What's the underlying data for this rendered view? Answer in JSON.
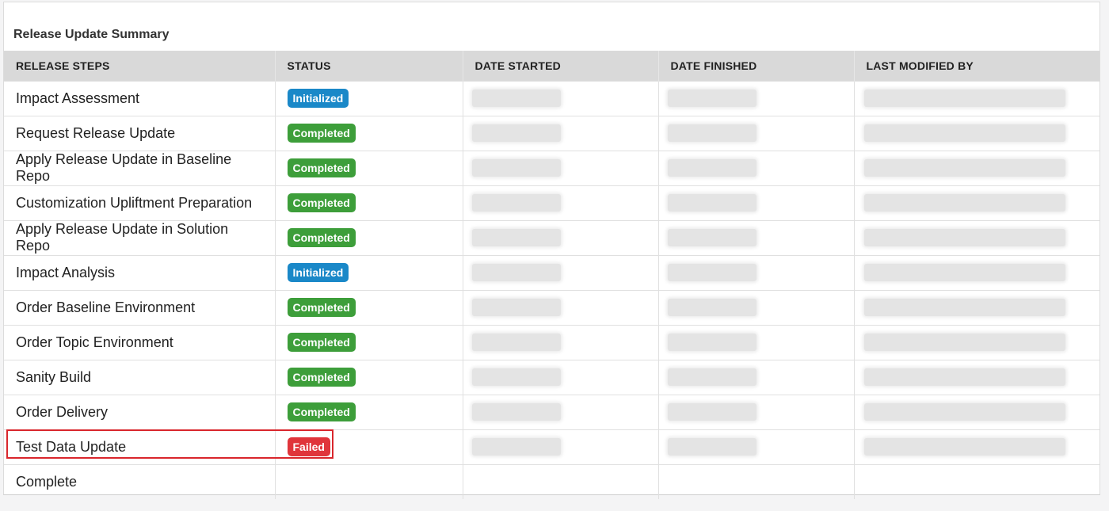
{
  "panel": {
    "title": "Release Update Summary"
  },
  "table": {
    "headers": [
      "RELEASE STEPS",
      "STATUS",
      "DATE STARTED",
      "DATE FINISHED",
      "LAST MODIFIED BY"
    ],
    "rows": [
      {
        "step": "Impact Assessment",
        "status": "Initialized"
      },
      {
        "step": "Request Release Update",
        "status": "Completed"
      },
      {
        "step": "Apply Release Update in Baseline Repo",
        "status": "Completed"
      },
      {
        "step": "Customization Upliftment Preparation",
        "status": "Completed"
      },
      {
        "step": "Apply Release Update in Solution Repo",
        "status": "Completed"
      },
      {
        "step": "Impact Analysis",
        "status": "Initialized"
      },
      {
        "step": "Order Baseline Environment",
        "status": "Completed"
      },
      {
        "step": "Order Topic Environment",
        "status": "Completed"
      },
      {
        "step": "Sanity Build",
        "status": "Completed"
      },
      {
        "step": "Order Delivery",
        "status": "Completed"
      },
      {
        "step": "Test Data Update",
        "status": "Failed"
      },
      {
        "step": "Complete",
        "status": ""
      }
    ]
  },
  "colors": {
    "initialized": "#1a88c8",
    "completed": "#3d9e3a",
    "failed": "#e0353b",
    "highlight": "#d9262c"
  }
}
